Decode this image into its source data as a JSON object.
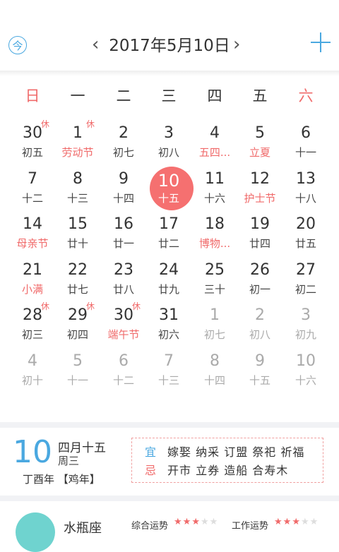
{
  "header": {
    "today_icon": "今",
    "title": "2017年5月10日",
    "prev_icon": "‹",
    "next_icon": "›",
    "add_icon": "plus-icon"
  },
  "weekdays": [
    "日",
    "一",
    "二",
    "三",
    "四",
    "五",
    "六"
  ],
  "weeks": [
    [
      {
        "d": "30",
        "l": "初五",
        "other": false,
        "rest": "休"
      },
      {
        "d": "1",
        "l": "劳动节",
        "red": true,
        "rest": "休"
      },
      {
        "d": "2",
        "l": "初七"
      },
      {
        "d": "3",
        "l": "初八"
      },
      {
        "d": "4",
        "l": "五四...",
        "red": true
      },
      {
        "d": "5",
        "l": "立夏",
        "red": true
      },
      {
        "d": "6",
        "l": "十一"
      }
    ],
    [
      {
        "d": "7",
        "l": "十二"
      },
      {
        "d": "8",
        "l": "十三"
      },
      {
        "d": "9",
        "l": "十四"
      },
      {
        "d": "10",
        "l": "十五",
        "today": true
      },
      {
        "d": "11",
        "l": "十六"
      },
      {
        "d": "12",
        "l": "护士节",
        "red": true
      },
      {
        "d": "13",
        "l": "十八"
      }
    ],
    [
      {
        "d": "14",
        "l": "母亲节",
        "red": true
      },
      {
        "d": "15",
        "l": "廿十"
      },
      {
        "d": "16",
        "l": "廿一"
      },
      {
        "d": "17",
        "l": "廿二"
      },
      {
        "d": "18",
        "l": "博物...",
        "red": true
      },
      {
        "d": "19",
        "l": "廿四"
      },
      {
        "d": "20",
        "l": "廿五"
      }
    ],
    [
      {
        "d": "21",
        "l": "小满",
        "red": true
      },
      {
        "d": "22",
        "l": "廿七"
      },
      {
        "d": "23",
        "l": "廿八"
      },
      {
        "d": "24",
        "l": "廿九"
      },
      {
        "d": "25",
        "l": "三十"
      },
      {
        "d": "26",
        "l": "初一"
      },
      {
        "d": "27",
        "l": "初二"
      }
    ],
    [
      {
        "d": "28",
        "l": "初三",
        "rest": "休"
      },
      {
        "d": "29",
        "l": "初四",
        "rest": "休"
      },
      {
        "d": "30",
        "l": "端午节",
        "red": true,
        "rest": "休"
      },
      {
        "d": "31",
        "l": "初六"
      },
      {
        "d": "1",
        "l": "初七",
        "other": true
      },
      {
        "d": "2",
        "l": "初八",
        "other": true
      },
      {
        "d": "3",
        "l": "初九",
        "other": true
      }
    ],
    [
      {
        "d": "4",
        "l": "初十",
        "other": true
      },
      {
        "d": "5",
        "l": "十一",
        "other": true
      },
      {
        "d": "6",
        "l": "十二",
        "other": true
      },
      {
        "d": "7",
        "l": "十三",
        "other": true
      },
      {
        "d": "8",
        "l": "十四",
        "other": true
      },
      {
        "d": "9",
        "l": "十五",
        "other": true
      },
      {
        "d": "10",
        "l": "十六",
        "other": true
      }
    ]
  ],
  "detail": {
    "day": "10",
    "lunar": "四月十五",
    "weekday": "周三",
    "ganzhi": "丁酉年 【鸡年】",
    "yi_label": "宜",
    "yi": "嫁娶 纳采 订盟 祭祀 祈福",
    "ji_label": "忌",
    "ji": "开市 立券 造船 合寿木"
  },
  "zodiac": {
    "name": "水瓶座",
    "overall_label": "综合运势",
    "overall_stars": 3,
    "work_label": "工作运势",
    "work_stars": 3,
    "star_max": 5
  },
  "colors": {
    "accent_blue": "#4aa8e0",
    "accent_red": "#f57070"
  }
}
